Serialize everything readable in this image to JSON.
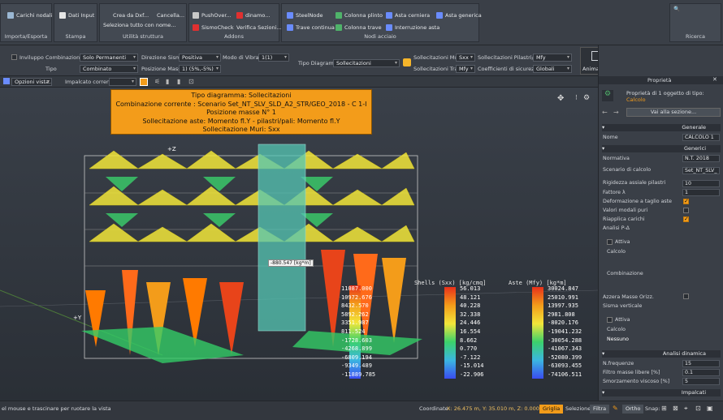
{
  "ribbon": {
    "groups": [
      {
        "title": "Importa/Esporta",
        "items": [
          "Carichi nodali"
        ]
      },
      {
        "title": "Stampa",
        "items": [
          "Dati Input"
        ]
      },
      {
        "title": "Utilità struttura",
        "items": [
          "Crea da Dxf...",
          "Cancella...",
          "Seleziona tutto con nome..."
        ]
      },
      {
        "title": "Addons",
        "items": [
          "PushOver...",
          "dinamo...",
          "SismoCheck",
          "Verifica Sezioni..."
        ]
      },
      {
        "title": "Nodi acciaio",
        "items": [
          "SteelNode",
          "Colonna plinto",
          "Asta cerniera",
          "Asta generica",
          "Trave continua",
          "Colonna trave",
          "Interruzione asta"
        ]
      },
      {
        "title": "Ricerca",
        "items": []
      }
    ]
  },
  "toolbar": {
    "inviluppo_label": "Inviluppo",
    "combinazione_label": "Combinazione",
    "combinazione_value": "Solo Permanenti",
    "tipo_label": "Tipo",
    "tipo_value": "Combinato",
    "direzione_sisma_label": "Direzione Sisma",
    "direzione_sisma_value": "Positiva",
    "posizione_masse_label": "Posizione Masse",
    "posizione_masse_value": "1) (5%,-5%)",
    "modo_vibrare_label": "Modo di Vibrare",
    "modo_vibrare_value": "1(1)",
    "tipo_diagramma_label": "Tipo Diagramma",
    "tipo_diagramma_value": "Sollecitazioni",
    "soll_muri_label": "Sollecitazioni Muri",
    "soll_muri_value": "Sxx",
    "soll_travi_label": "Sollecitazioni Travi",
    "soll_travi_value": "Mfy",
    "soll_pilastri_label": "Sollecitazioni Pilastri/Pali",
    "soll_pilastri_value": "Mfy",
    "coeff_sicurezza_label": "Coefficienti di sicurezza",
    "coeff_sicurezza_value": "Globali",
    "animazioni_label": "Animazioni"
  },
  "viewbar": {
    "opzioni_vista": "Opzioni vista...",
    "impalcato_label": "Impalcato corrente:"
  },
  "infobox": {
    "line1": "Tipo diagramma: Sollecitazioni",
    "line2": "Combinazione corrente : Scenario Set_NT_SLV_SLD_A2_STR/GEO_2018 - C 1-I",
    "line3": "Posizione masse N° 1",
    "line4": "Sollecitazione aste: Momento fl.Y - pilastri/pali: Momento fl.Y",
    "line5": "Sollecitazione Muri: Sxx"
  },
  "viewport": {
    "axis_z": "+Z",
    "axis_y": "+Y",
    "tooltip_value": "-880.547 [kg*m]"
  },
  "legends": [
    {
      "title": "",
      "values": [
        "11087.000",
        "10972.676",
        "8432.570",
        "5892.262",
        "3351.987",
        "811.524",
        "-1728.603",
        "-4268.899",
        "-6809.194",
        "-9349.489",
        "-11889.785"
      ]
    },
    {
      "title": "Shells (Sxx) [kg/cmq]",
      "values": [
        "56.013",
        "48.121",
        "40.228",
        "32.338",
        "24.446",
        "16.554",
        "8.662",
        "0.770",
        "-7.122",
        "-15.014",
        "-22.906"
      ]
    },
    {
      "title": "Aste (Mfy) [kg*m]",
      "values": [
        "30024.847",
        "25010.991",
        "13997.935",
        "2981.808",
        "-8020.176",
        "-19041.232",
        "-30054.288",
        "-41067.343",
        "-52080.399",
        "-63093.455",
        "-74106.511"
      ]
    }
  ],
  "panel": {
    "title": "Proprietà",
    "selection_text": "Proprietà di 1 oggetto di tipo:",
    "selection_type": "Calcolo",
    "vai_button": "Vai alla sezione...",
    "sections": {
      "generale": "Generale",
      "generici": "Generici",
      "analisi_dinamica": "Analisi dinamica",
      "impalcati": "Impalcati"
    },
    "props": {
      "nome_label": "Nome",
      "nome_value": "CALCOLO 1",
      "normativa_label": "Normativa",
      "normativa_value": "N.T. 2018",
      "scenario_label": "Scenario di calcolo",
      "scenario_value": "Set_NT_SLV_",
      "rigidezza_label": "Rigidezza assiale pilastri",
      "rigidezza_value": "10",
      "fattore_label": "Fattore λ",
      "fattore_value": "1",
      "deformazione_label": "Deformazione a taglio aste",
      "valori_label": "Valori modali puri",
      "riapplica_label": "Riapplica carichi",
      "analisi_pdelta_label": "Analisi P-Δ",
      "attiva_label": "Attiva",
      "calcolo_label": "Calcolo",
      "combinazione_label": "Combinazione",
      "azzera_label": "Azzera Masse Orizz.",
      "sisma_verticale_label": "Sisma verticale",
      "attiva2_label": "Attiva",
      "calcolo2_label": "Calcolo",
      "nessuno_label": "Nessuno",
      "nfrequenze_label": "N.frequenze",
      "nfrequenze_value": "15",
      "filtro_label": "Filtro masse libere [%]",
      "filtro_value": "0.1",
      "smorzamento_label": "Smorzamento viscoso [%]",
      "smorzamento_value": "5"
    }
  },
  "status": {
    "hint": "el mouse e trascinare per ruotare la vista",
    "coord_label": "Coordinate",
    "coord_value": "X: 26.475 m, Y: 35.010 m, Z: 0.000 m",
    "griglia": "Griglia",
    "selezione_label": "Selezione",
    "filtra": "Filtra",
    "ortho": "Ortho",
    "snap_label": "Snap:"
  }
}
